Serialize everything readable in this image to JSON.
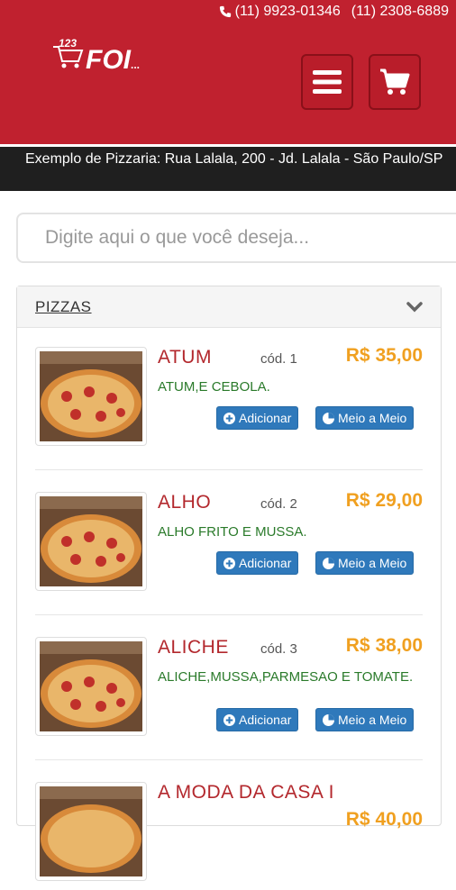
{
  "header": {
    "phones": [
      "(11) 9923-01346",
      "(11) 2308-6889"
    ],
    "logo_text": "123 FOI..."
  },
  "store": {
    "address_line": "Exemplo de Pizzaria: Rua Lalala, 200 - Jd. Lalala - São Paulo/SP"
  },
  "search": {
    "placeholder": "Digite aqui o que você deseja..."
  },
  "category": {
    "title": "PIZZAS"
  },
  "buttons": {
    "add_label": "Adicionar",
    "half_label": "Meio a Meio"
  },
  "products": [
    {
      "name": "ATUM",
      "code": "cód. 1",
      "price": "R$ 35,00",
      "description": "ATUM,E CEBOLA."
    },
    {
      "name": "ALHO",
      "code": "cód. 2",
      "price": "R$ 29,00",
      "description": "ALHO FRITO E MUSSA."
    },
    {
      "name": "ALICHE",
      "code": "cód. 3",
      "price": "R$ 38,00",
      "description": "ALICHE,MUSSA,PARMESAO E TOMATE."
    },
    {
      "name": "A MODA DA CASA I",
      "price": "R$ 40,00"
    }
  ],
  "colors": {
    "brand_red": "#c0212f",
    "price_orange": "#f0a020",
    "button_blue": "#2f79bb",
    "desc_green": "#2a7a2a"
  }
}
